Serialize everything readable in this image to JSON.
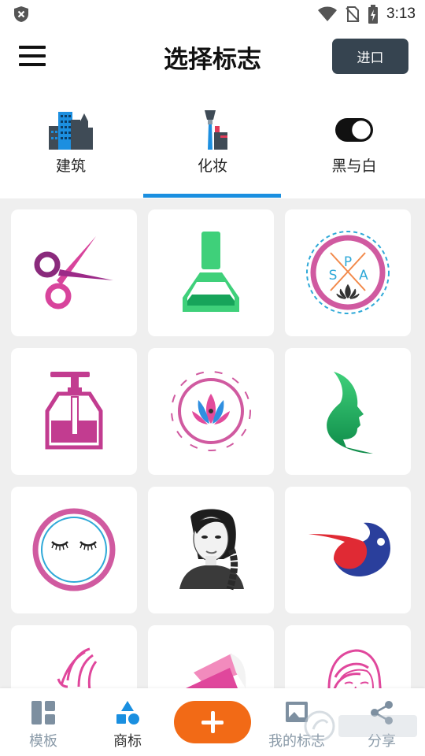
{
  "status_bar": {
    "time": "3:13"
  },
  "header": {
    "title": "选择标志",
    "import_label": "进口"
  },
  "tabs": [
    {
      "label": "建筑",
      "icon": "buildings-icon"
    },
    {
      "label": "化妆",
      "icon": "makeup-icon",
      "active": true
    },
    {
      "label": "黑与白",
      "icon": "black-white-toggle-icon"
    }
  ],
  "logos": [
    {
      "icon": "scissors-icon"
    },
    {
      "icon": "nail-polish-icon"
    },
    {
      "icon": "spa-lotus-emblem-icon",
      "text": [
        "S",
        "P",
        "A"
      ]
    },
    {
      "icon": "soap-dispenser-icon"
    },
    {
      "icon": "lotus-badge-icon"
    },
    {
      "icon": "green-face-profile-icon"
    },
    {
      "icon": "closed-eyes-circle-icon"
    },
    {
      "icon": "braided-woman-portrait-icon"
    },
    {
      "icon": "red-blue-swoosh-icon"
    },
    {
      "icon": "pink-hair-line-icon"
    },
    {
      "icon": "pink-petals-icon"
    },
    {
      "icon": "pink-woman-face-icon"
    }
  ],
  "bottom_nav": {
    "templates_label": "模板",
    "logos_label": "商标",
    "my_logos_label": "我的标志",
    "share_label": "分享"
  },
  "colors": {
    "accent_blue": "#1a8fe0",
    "fab_orange": "#f26a16",
    "import_button": "#364450",
    "nav_inactive": "#8a9aa8"
  }
}
